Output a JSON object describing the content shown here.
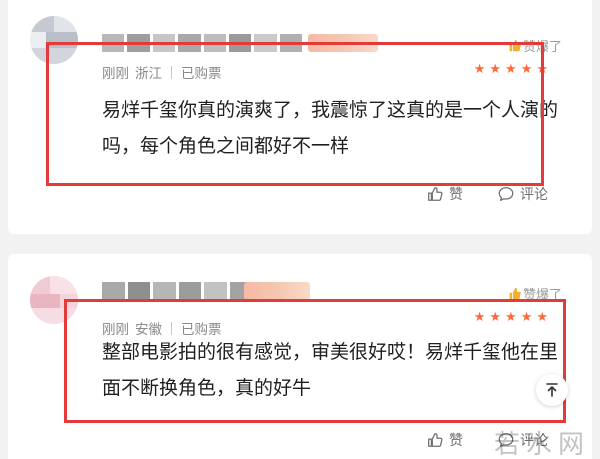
{
  "comments": [
    {
      "hot_label": "赞爆了",
      "time": "刚刚",
      "location": "浙江",
      "status": "已购票",
      "rating": 5,
      "content": "易烊千玺你真的演爽了，我震惊了这真的是一个人演的吗，每个角色之间都好不一样",
      "like_label": "赞",
      "comment_label": "评论"
    },
    {
      "hot_label": "赞爆了",
      "time": "刚刚",
      "location": "安徽",
      "status": "已购票",
      "rating": 5,
      "content": "整部电影拍的很有感觉，审美很好哎！易烊千玺他在里面不断换角色，真的好牛",
      "like_label": "赞",
      "comment_label": "评论"
    }
  ],
  "watermark": "若水网",
  "colors": {
    "highlight_border": "#e33a3a",
    "star": "#ff6a3d",
    "hot_thumb": "#f0b22e"
  },
  "icons": {
    "like": "thumbs-up-icon",
    "comment": "speech-bubble-icon",
    "hot": "gold-thumb-icon",
    "scroll_top": "arrow-to-top-icon"
  }
}
